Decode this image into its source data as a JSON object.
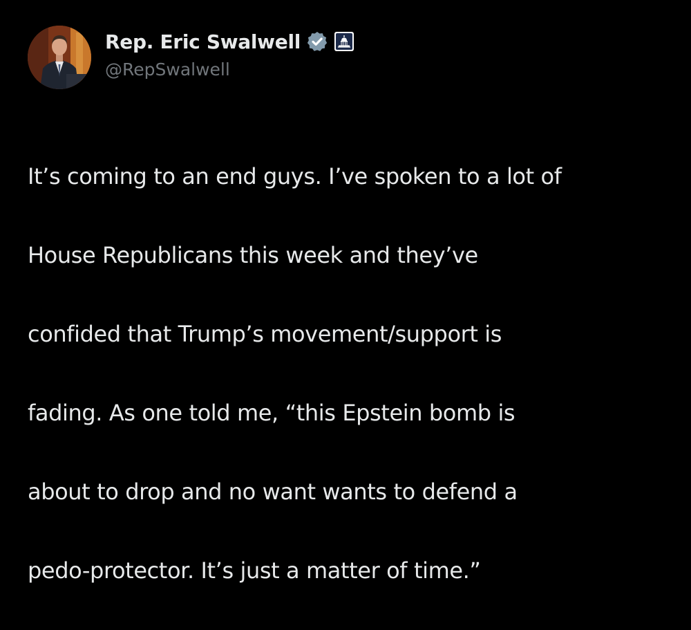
{
  "author": {
    "display_name": "Rep. Eric Swalwell",
    "handle": "@RepSwalwell",
    "verified_icon": "verified-check-icon",
    "affiliation_icon": "government-capitol-icon",
    "avatar_icon": "avatar"
  },
  "post": {
    "text_lines": [
      "It’s coming to an end guys. I’ve spoken to a lot of",
      "House Republicans this week and they’ve",
      "confided that Trump’s movement/support is",
      "fading. As one told me, “this Epstein bomb is",
      "about to drop and no want wants to defend a",
      "pedo-protector. It’s just a matter of time.”"
    ]
  },
  "more_icon": "more-options-icon",
  "colors": {
    "background": "#000000",
    "text": "#e7e9ea",
    "secondary": "#71767b",
    "verified": "#829aab"
  }
}
